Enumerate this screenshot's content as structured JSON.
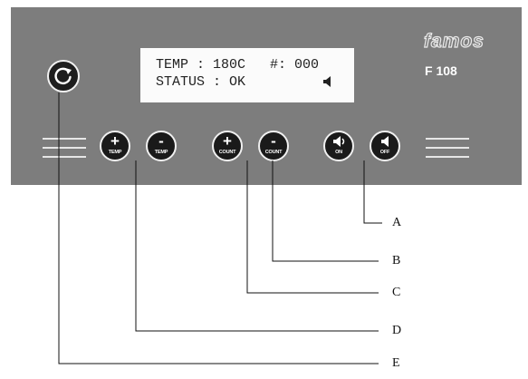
{
  "panel": {
    "brand": "famos",
    "model": "F 108",
    "display": {
      "line1": "TEMP : 180C   #: 000",
      "line2": "STATUS : OK"
    },
    "buttons": [
      {
        "symbol": "+",
        "label": "TEMP"
      },
      {
        "symbol": "-",
        "label": "TEMP"
      },
      {
        "symbol": "+",
        "label": "COUNT"
      },
      {
        "symbol": "-",
        "label": "COUNT"
      },
      {
        "symbol": "speaker-on-icon",
        "label": "ON"
      },
      {
        "symbol": "speaker-off-icon",
        "label": "OFF"
      }
    ]
  },
  "callouts": [
    "A",
    "B",
    "C",
    "D",
    "E"
  ],
  "colors": {
    "panel": "#7d7d7d",
    "button": "#1a1a1a",
    "display": "#fbfbfb"
  }
}
